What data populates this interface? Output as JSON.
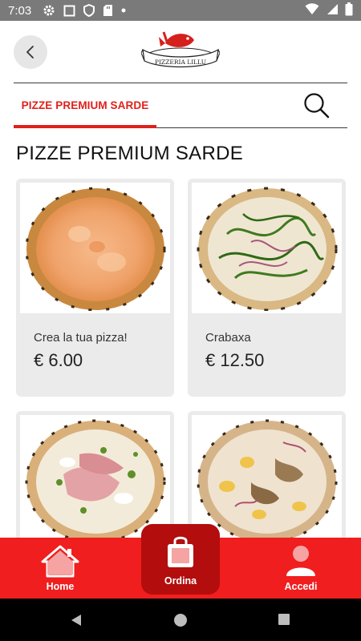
{
  "status_bar": {
    "time": "7:03",
    "icons": [
      "gear-icon",
      "square-icon",
      "shield-icon",
      "sd-card-icon",
      "dot-icon"
    ],
    "right_icons": [
      "wifi-icon",
      "signal-icon",
      "battery-icon"
    ]
  },
  "header": {
    "back_icon": "chevron-left-icon",
    "logo_text": "PIZZERIA LILLU"
  },
  "category_bar": {
    "active_tab": "PIZZE PREMIUM SARDE",
    "search_icon": "search-icon"
  },
  "section": {
    "title": "PIZZE PREMIUM SARDE"
  },
  "products": [
    {
      "name": "Crea la tua pizza!",
      "price": "€ 6.00"
    },
    {
      "name": "Crabaxa",
      "price": "€ 12.50"
    },
    {
      "name": "",
      "price": ""
    },
    {
      "name": "",
      "price": ""
    }
  ],
  "bottom_nav": {
    "home_label": "Home",
    "order_label": "Ordina",
    "login_label": "Accedi"
  },
  "colors": {
    "accent": "#e0201a",
    "nav_bg": "#f01e1e",
    "nav_center_bg": "#b30d0d",
    "card_bg": "#ebebeb"
  }
}
